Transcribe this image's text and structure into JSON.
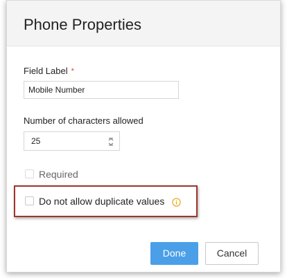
{
  "dialog": {
    "title": "Phone Properties"
  },
  "field_label": {
    "label": "Field Label",
    "required_marker": "*",
    "value": "Mobile Number"
  },
  "max_chars": {
    "label": "Number of characters allowed",
    "value": "25",
    "stepper_icon": "spinner-arrows-icon"
  },
  "required_option": {
    "label": "Required",
    "checked": false,
    "disabled": true
  },
  "no_duplicates_option": {
    "label": "Do not allow duplicate values",
    "checked": false,
    "info_icon": "info-icon",
    "highlight_color": "#a0342c"
  },
  "actions": {
    "done_label": "Done",
    "cancel_label": "Cancel",
    "primary_color": "#4a9fe8"
  }
}
